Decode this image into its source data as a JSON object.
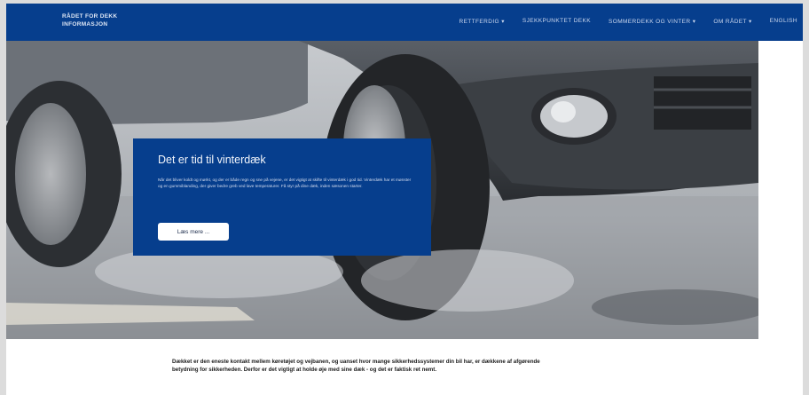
{
  "header": {
    "logo_text": "Rådet for Dekk Informasjon",
    "nav": [
      {
        "label": "Rettferdig ▾"
      },
      {
        "label": "Sjekkpunktet Dekk"
      },
      {
        "label": "Sommerdekk og vinter ▾"
      },
      {
        "label": "Om rådet ▾"
      },
      {
        "label": "English"
      }
    ]
  },
  "hero": {
    "title": "Det er tid til vinterdæk",
    "text": "Når det bliver koldt og mørkt, og der er både regn og sne på vejene, er det vigtigt at skifte til vinterdæk i god tid. Vinterdæk har et mønster og en gummiblanding, der giver bedre greb ved lave temperaturer. Få styr på dine dæk, inden sæsonen starter.",
    "button_label": "Læs mere ..."
  },
  "article": {
    "text": "Dækket er den eneste kontakt mellem køretøjet og vejbanen, og uanset hvor mange sikkerhedssystemer din bil har, er dækkene af afgørende betydning for sikkerheden. Derfor er det vigtigt at holde øje med sine dæk - og det er faktisk ret nemt."
  },
  "colors": {
    "brand_blue": "#063e8d",
    "button_white": "#ffffff"
  }
}
